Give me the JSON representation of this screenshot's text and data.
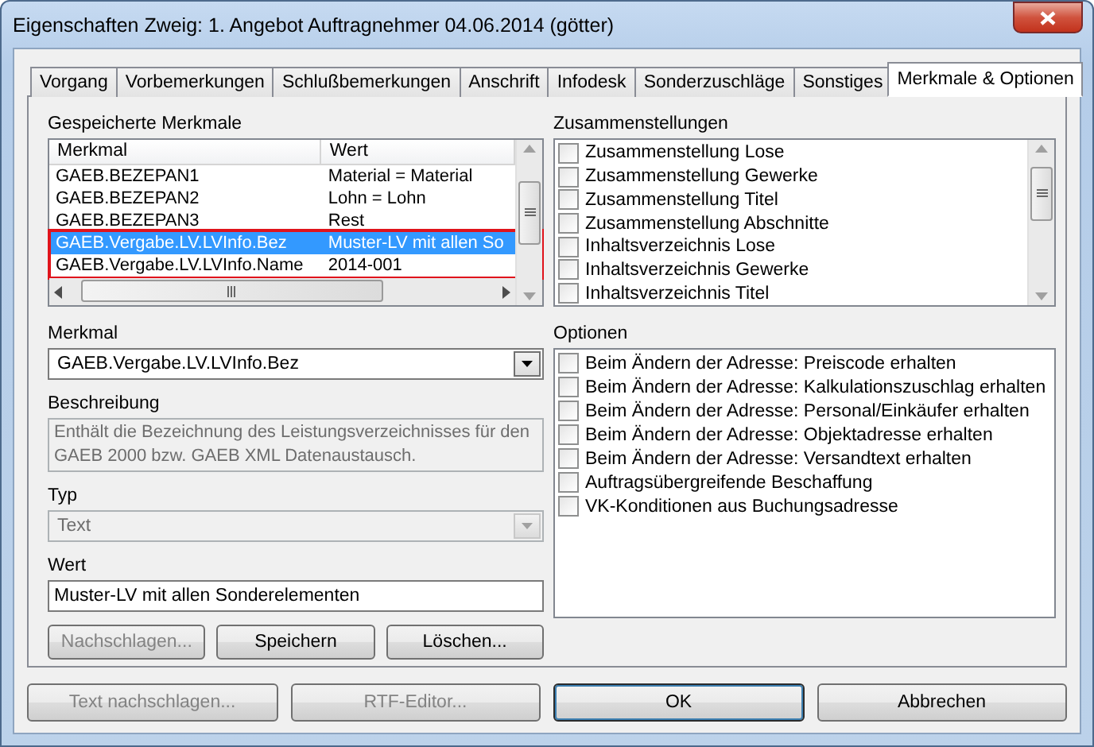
{
  "window": {
    "title": "Eigenschaften Zweig: 1. Angebot Auftragnehmer 04.06.2014 (götter)"
  },
  "tabs": [
    {
      "label": "Vorgang",
      "selected": false
    },
    {
      "label": "Vorbemerkungen",
      "selected": false
    },
    {
      "label": "Schlußbemerkungen",
      "selected": false
    },
    {
      "label": "Anschrift",
      "selected": false
    },
    {
      "label": "Infodesk",
      "selected": false
    },
    {
      "label": "Sonderzuschläge",
      "selected": false
    },
    {
      "label": "Sonstiges",
      "selected": false
    },
    {
      "label": "Merkmale & Optionen",
      "selected": true
    }
  ],
  "saved_features": {
    "label": "Gespeicherte Merkmale",
    "columns": [
      "Merkmal",
      "Wert"
    ],
    "rows": [
      {
        "merkmal": "GAEB.BEZEPAN1",
        "wert": "Material = Material",
        "selected": false,
        "highlighted": false
      },
      {
        "merkmal": "GAEB.BEZEPAN2",
        "wert": "Lohn = Lohn",
        "selected": false,
        "highlighted": false
      },
      {
        "merkmal": "GAEB.BEZEPAN3",
        "wert": "Rest",
        "selected": false,
        "highlighted": false
      },
      {
        "merkmal": "GAEB.Vergabe.LV.LVInfo.Bez",
        "wert": "Muster-LV mit allen So",
        "selected": true,
        "highlighted": true
      },
      {
        "merkmal": "GAEB.Vergabe.LV.LVInfo.Name",
        "wert": "2014-001",
        "selected": false,
        "highlighted": true
      }
    ]
  },
  "merkmal": {
    "label": "Merkmal",
    "value": "GAEB.Vergabe.LV.LVInfo.Bez",
    "disabled": false
  },
  "beschreibung": {
    "label": "Beschreibung",
    "value": "Enthält die Bezeichnung des Leistungsverzeichnisses für den GAEB 2000 bzw. GAEB XML Datenaustausch.",
    "disabled": true
  },
  "typ": {
    "label": "Typ",
    "value": "Text",
    "disabled": true
  },
  "wert": {
    "label": "Wert",
    "value": "Muster-LV mit allen Sonderelementen"
  },
  "feature_buttons": [
    {
      "label": "Nachschlagen...",
      "disabled": true
    },
    {
      "label": "Speichern",
      "disabled": false
    },
    {
      "label": "Löschen...",
      "disabled": false
    }
  ],
  "zusammenstellungen": {
    "label": "Zusammenstellungen",
    "items": [
      {
        "label": "Zusammenstellung Lose",
        "checked": false
      },
      {
        "label": "Zusammenstellung Gewerke",
        "checked": false
      },
      {
        "label": "Zusammenstellung Titel",
        "checked": false
      },
      {
        "label": "Zusammenstellung Abschnitte",
        "checked": false
      },
      {
        "label": "Inhaltsverzeichnis Lose",
        "checked": false
      },
      {
        "label": "Inhaltsverzeichnis Gewerke",
        "checked": false
      },
      {
        "label": "Inhaltsverzeichnis Titel",
        "checked": false
      }
    ]
  },
  "optionen": {
    "label": "Optionen",
    "items": [
      {
        "label": "Beim Ändern der Adresse: Preiscode erhalten",
        "checked": false
      },
      {
        "label": "Beim Ändern der Adresse: Kalkulationszuschlag erhalten",
        "checked": false
      },
      {
        "label": "Beim Ändern der Adresse: Personal/Einkäufer erhalten",
        "checked": false
      },
      {
        "label": "Beim Ändern der Adresse: Objektadresse erhalten",
        "checked": false
      },
      {
        "label": "Beim Ändern der Adresse: Versandtext erhalten",
        "checked": false
      },
      {
        "label": "Auftragsübergreifende Beschaffung",
        "checked": false
      },
      {
        "label": "VK-Konditionen aus Buchungsadresse",
        "checked": false
      }
    ]
  },
  "dialog_buttons": [
    {
      "label": "Text nachschlagen...",
      "disabled": true,
      "default": false
    },
    {
      "label": "RTF-Editor...",
      "disabled": true,
      "default": false
    },
    {
      "label": "OK",
      "disabled": false,
      "default": true
    },
    {
      "label": "Abbrechen",
      "disabled": false,
      "default": false
    }
  ]
}
